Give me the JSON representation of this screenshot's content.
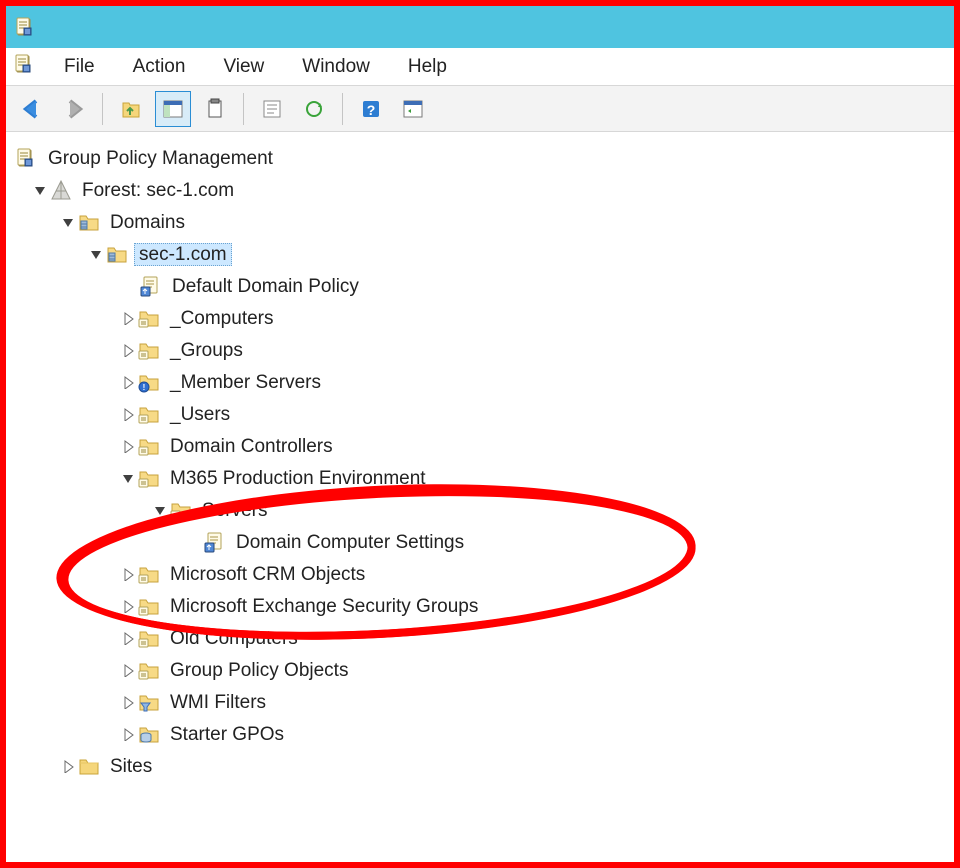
{
  "menu": {
    "file": "File",
    "action": "Action",
    "view": "View",
    "window": "Window",
    "help": "Help"
  },
  "tree": {
    "root": "Group Policy Management",
    "forest": "Forest: sec-1.com",
    "domains": "Domains",
    "domain_name": "sec-1.com",
    "default_domain_policy": "Default Domain Policy",
    "computers": "_Computers",
    "groups": "_Groups",
    "member_servers": "_Member Servers",
    "users": "_Users",
    "domain_controllers": "Domain Controllers",
    "m365_env": "M365 Production Environment",
    "servers": "Servers",
    "dom_comp_settings": "Domain Computer Settings",
    "ms_crm": "Microsoft CRM Objects",
    "ms_ex_sec": "Microsoft Exchange Security Groups",
    "old_computers": "Old Computers",
    "gpo": "Group Policy Objects",
    "wmi": "WMI Filters",
    "starter_gpos": "Starter GPOs",
    "sites": "Sites"
  }
}
